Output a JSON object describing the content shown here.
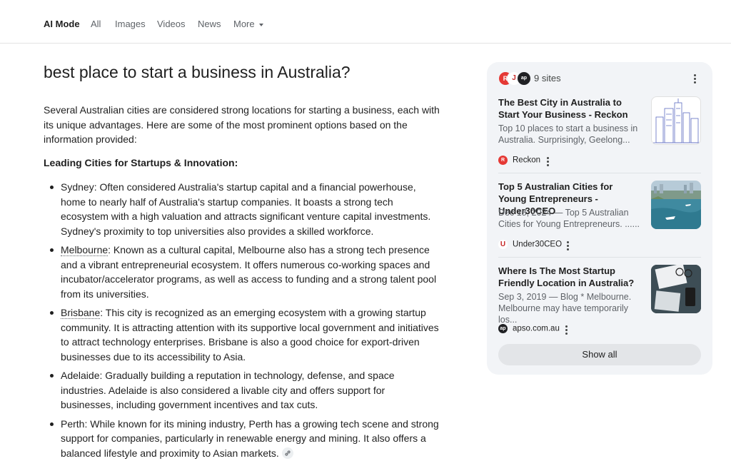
{
  "nav": {
    "tabs": [
      "AI Mode",
      "All",
      "Images",
      "Videos",
      "News",
      "More"
    ]
  },
  "answer": {
    "query": "best place to start a business in Australia?",
    "intro": "Several Australian cities are considered strong locations for starting a business, each with its unique advantages. Here are some of the most prominent options based on the information provided:",
    "section_heading": "Leading Cities for Startups & Innovation:",
    "items": [
      {
        "term": "Sydney",
        "text": ": Often considered Australia's startup capital and a financial powerhouse, home to nearly half of Australia's startup companies. It boasts a strong tech ecosystem with a high valuation and attracts significant venture capital investments. Sydney's proximity to top universities also provides a skilled workforce."
      },
      {
        "term": "Melbourne",
        "text": ": Known as a cultural capital, Melbourne also has a strong tech presence and a vibrant entrepreneurial ecosystem. It offers numerous co-working spaces and incubator/accelerator programs, as well as access to funding and a strong talent pool from its universities."
      },
      {
        "term": "Brisbane",
        "text": ": This city is recognized as an emerging ecosystem with a growing startup community. It is attracting attention with its supportive local government and initiatives to attract technology enterprises. Brisbane is also a good choice for export-driven businesses due to its accessibility to Asia."
      },
      {
        "term": "Adelaide",
        "text": ": Gradually building a reputation in technology, defense, and space industries. Adelaide is also considered a livable city and offers support for businesses, including government incentives and tax cuts."
      },
      {
        "term": "Perth",
        "text": ": While known for its mining industry, Perth has a growing tech scene and strong support for companies, particularly in renewable energy and mining. It also offers a balanced lifestyle and proximity to Asian markets."
      }
    ]
  },
  "sources": {
    "count_label": "9 sites",
    "show_all": "Show all",
    "cards": [
      {
        "title": "The Best City in Australia to Start Your Business - Reckon",
        "snippet": "Top 10 places to start a business in Australia. Surprisingly, Geelong...",
        "source": "Reckon",
        "icon": "reckon-logo-icon",
        "color": "#e53935"
      },
      {
        "title": "Top 5 Australian Cities for Young Entrepreneurs - Under30CEO",
        "snippet": "Dec 18, 2024 — Top 5 Australian Cities for Young Entrepreneurs. ......",
        "source": "Under30CEO",
        "icon": "under30ceo-logo-icon",
        "color": "#c62828"
      },
      {
        "title": "Where Is The Most Startup Friendly Location in Australia?",
        "snippet": "Sep 3, 2019 — Blog * Melbourne. Melbourne may have temporarily los...",
        "source": "apso.com.au",
        "icon": "apso-logo-icon",
        "color": "#202124"
      }
    ]
  },
  "colors": {
    "accent": "#1f1f1f",
    "muted": "#5f6368",
    "panel_bg": "#f2f4f7"
  }
}
